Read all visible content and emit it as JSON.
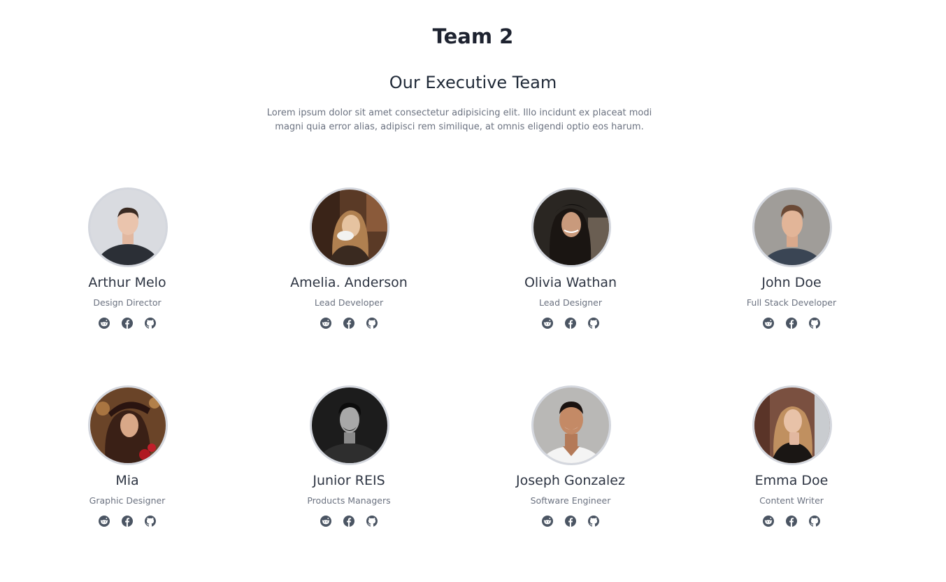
{
  "page": {
    "title": "Team 2"
  },
  "section": {
    "title": "Our Executive Team",
    "intro": "Lorem ipsum dolor sit amet consectetur adipisicing elit. Illo incidunt ex placeat modi magni quia error alias, adipisci rem similique, at omnis eligendi optio eos harum."
  },
  "members": [
    {
      "name": "Arthur Melo",
      "role": "Design Director"
    },
    {
      "name": "Amelia. Anderson",
      "role": "Lead Developer"
    },
    {
      "name": "Olivia Wathan",
      "role": "Lead Designer"
    },
    {
      "name": "John Doe",
      "role": "Full Stack Developer"
    },
    {
      "name": "Mia",
      "role": "Graphic Designer"
    },
    {
      "name": "Junior REIS",
      "role": "Products Managers"
    },
    {
      "name": "Joseph Gonzalez",
      "role": "Software Engineer"
    },
    {
      "name": "Emma Doe",
      "role": "Content Writer"
    }
  ],
  "social_icons": [
    "reddit-icon",
    "facebook-icon",
    "github-icon"
  ],
  "colors": {
    "icon": "#4b5563",
    "avatar_border": "#d4d7de",
    "heading": "#1e2330",
    "muted": "#6b7280"
  }
}
